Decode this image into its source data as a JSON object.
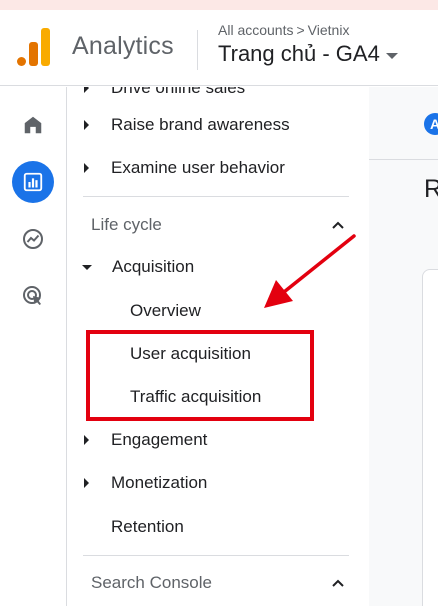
{
  "header": {
    "app_title": "Analytics",
    "breadcrumb": {
      "account": "All accounts",
      "separator": ">",
      "property_parent": "Vietnix"
    },
    "property_name": "Trang chủ - GA4"
  },
  "rail": {
    "items": [
      {
        "icon": "home-icon",
        "active": false
      },
      {
        "icon": "reports-icon",
        "active": true
      },
      {
        "icon": "explore-icon",
        "active": false
      },
      {
        "icon": "advertising-icon",
        "active": false
      }
    ]
  },
  "nav": {
    "partial_item": "Drive online sales",
    "items_top": [
      "Raise brand awareness",
      "Examine user behavior"
    ],
    "life_cycle_header": "Life cycle",
    "acquisition": "Acquisition",
    "acquisition_children": [
      "Overview",
      "User acquisition",
      "Traffic acquisition"
    ],
    "engagement": "Engagement",
    "monetization": "Monetization",
    "retention": "Retention",
    "search_console_header": "Search Console"
  },
  "main": {
    "chip_letter": "A",
    "title_partial": "R"
  },
  "colors": {
    "accent": "#1a73e8",
    "highlight": "#e3000f",
    "logo_orange": "#e37400",
    "logo_yellow": "#f9ab00"
  }
}
